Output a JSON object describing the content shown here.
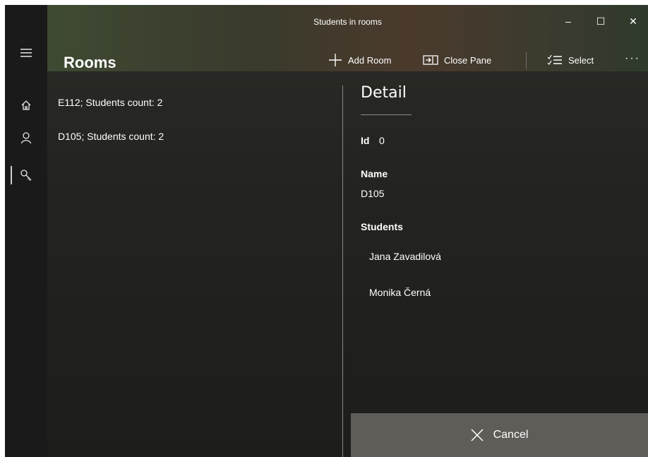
{
  "window": {
    "title": "Students in rooms",
    "minimize": "–",
    "maximize": "☐",
    "close": "✕"
  },
  "nav": {
    "menu_icon": "hamburger-icon",
    "items": [
      {
        "icon": "home-icon"
      },
      {
        "icon": "person-icon"
      },
      {
        "icon": "key-icon"
      }
    ]
  },
  "header": {
    "title": "Rooms"
  },
  "commands": {
    "add": {
      "label": "Add Room",
      "icon": "plus-icon"
    },
    "close_pane": {
      "label": "Close Pane",
      "icon": "close-pane-icon"
    },
    "select": {
      "label": "Select",
      "icon": "multiselect-icon"
    },
    "more": "···"
  },
  "rooms": [
    {
      "text": "E112; Students count: 2"
    },
    {
      "text": "D105; Students count: 2"
    }
  ],
  "detail": {
    "header": "Detail",
    "id_label": "Id",
    "id_value": "0",
    "name_label": "Name",
    "name_value": "D105",
    "students_label": "Students",
    "students": [
      "Jana Zavadilová",
      "Monika Černá"
    ]
  },
  "cancel": {
    "label": "Cancel",
    "icon": "close-icon"
  }
}
